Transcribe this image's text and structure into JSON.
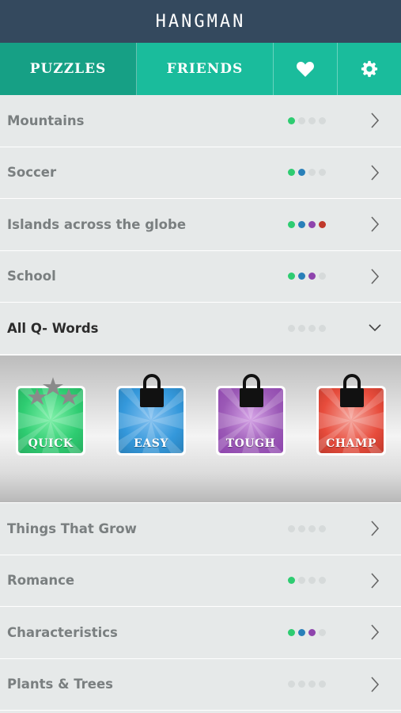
{
  "app": {
    "title": "HANGMAN"
  },
  "tabs": [
    {
      "label": "PUZZLES",
      "active": true
    },
    {
      "label": "FRIENDS",
      "active": false
    },
    {
      "icon": "heart-icon"
    },
    {
      "icon": "gear-icon"
    }
  ],
  "colors": {
    "header": "#34495e",
    "tab": "#1abc9c",
    "tab_active": "#16a085",
    "green": "#2ecc71",
    "blue": "#2980b9",
    "purple": "#8e44ad",
    "red": "#c0392b",
    "empty": "#d6dada"
  },
  "puzzles": [
    {
      "label": "Mountains",
      "progress": [
        "green",
        "empty",
        "empty",
        "empty"
      ],
      "expanded": false
    },
    {
      "label": "Soccer",
      "progress": [
        "green",
        "blue",
        "empty",
        "empty"
      ],
      "expanded": false
    },
    {
      "label": "Islands across the globe",
      "progress": [
        "green",
        "blue",
        "purple",
        "red"
      ],
      "expanded": false
    },
    {
      "label": "School",
      "progress": [
        "green",
        "blue",
        "purple",
        "empty"
      ],
      "expanded": false
    },
    {
      "label": "All Q- Words",
      "progress": [
        "empty",
        "empty",
        "empty",
        "empty"
      ],
      "expanded": true
    },
    {
      "label": "Things That Grow",
      "progress": [
        "empty",
        "empty",
        "empty",
        "empty"
      ],
      "expanded": false
    },
    {
      "label": "Romance",
      "progress": [
        "green",
        "empty",
        "empty",
        "empty"
      ],
      "expanded": false
    },
    {
      "label": "Characteristics",
      "progress": [
        "green",
        "blue",
        "purple",
        "empty"
      ],
      "expanded": false
    },
    {
      "label": "Plants & Trees",
      "progress": [
        "empty",
        "empty",
        "empty",
        "empty"
      ],
      "expanded": false
    }
  ],
  "levels": [
    {
      "label": "QUICK",
      "color": "#2ecc71",
      "locked": false,
      "stars": 3
    },
    {
      "label": "EASY",
      "color": "#3498db",
      "locked": true
    },
    {
      "label": "TOUGH",
      "color": "#9b59b6",
      "locked": true
    },
    {
      "label": "CHAMP",
      "color": "#e74c3c",
      "locked": true
    }
  ]
}
